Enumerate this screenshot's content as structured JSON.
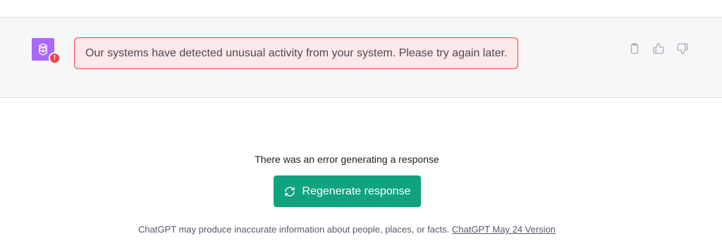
{
  "message": {
    "error_text": "Our systems have detected unusual activity from your system. Please try again later.",
    "avatar_icon": "openai-logo-icon",
    "status_icon": "error-icon",
    "status_glyph": "!",
    "avatar_color": "#ab68ff",
    "error_color": "#ef4146"
  },
  "actions": {
    "copy_icon": "clipboard-icon",
    "like_icon": "thumbs-up-icon",
    "dislike_icon": "thumbs-down-icon"
  },
  "generation": {
    "error_message": "There was an error generating a response",
    "regenerate_label": "Regenerate response",
    "regenerate_icon": "refresh-icon",
    "accent_color": "#10a37f"
  },
  "footer": {
    "disclaimer": "ChatGPT may produce inaccurate information about people, places, or facts.",
    "version_link": "ChatGPT May 24 Version"
  }
}
